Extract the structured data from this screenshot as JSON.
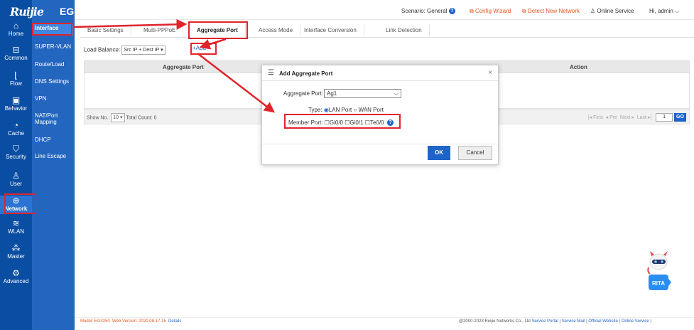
{
  "brand": {
    "logo": "Ruijie",
    "product": "EG"
  },
  "iconbar": {
    "items": [
      {
        "label": "Home",
        "icon": "home-icon",
        "glyph": "⌂"
      },
      {
        "label": "Common",
        "icon": "briefcase-icon",
        "glyph": "⊟"
      },
      {
        "label": "Flow",
        "icon": "chart-icon",
        "glyph": "⌊"
      },
      {
        "label": "Behavior",
        "icon": "behavior-icon",
        "glyph": "▣"
      },
      {
        "label": "Cache",
        "icon": "gauge-icon",
        "glyph": "◔"
      },
      {
        "label": "Security",
        "icon": "shield-icon",
        "glyph": "⛉"
      },
      {
        "label": "User",
        "icon": "user-icon",
        "glyph": "♙"
      },
      {
        "label": "Network",
        "icon": "globe-icon",
        "glyph": "⊕"
      },
      {
        "label": "WLAN",
        "icon": "wifi-icon",
        "glyph": "≋"
      },
      {
        "label": "Master",
        "icon": "tree-icon",
        "glyph": "⁂"
      },
      {
        "label": "Advanced",
        "icon": "gear-icon",
        "glyph": "⚙"
      }
    ]
  },
  "subnav": {
    "items": [
      "Interface",
      "SUPER-VLAN",
      "Route/Load",
      "DNS Settings",
      "VPN",
      "NAT/Port Mapping",
      "DHCP",
      "Line Escape"
    ],
    "active": "Interface"
  },
  "topbar": {
    "scenario": "Scenario: General",
    "config_wizard": "Config Wizard",
    "detect_network": "Detect New Network",
    "online_service": "Online Service",
    "user_greeting": "Hi, admin"
  },
  "tabs": [
    "Basic Settings",
    "Multi-PPPoE",
    "Aggregate Port",
    "Access Mode",
    "Interface Conversion",
    "Link Detection"
  ],
  "active_tab": "Aggregate Port",
  "toolbar": {
    "load_balance_label": "Load Balance:",
    "load_balance_value": "Src IP + Dest IP",
    "add_label": "Add"
  },
  "table": {
    "columns": [
      "Aggregate Port",
      "Action"
    ],
    "show_no_label": "Show No.:",
    "show_no_value": "10",
    "total_count": "Total Count: 0",
    "pager": {
      "first": "First",
      "prev": "Pre",
      "next": "Next",
      "last": "Last",
      "page": "1",
      "go": "GO"
    }
  },
  "modal": {
    "title": "Add Aggregate Port",
    "close": "×",
    "aggregate_port_label": "Aggregate Port:",
    "aggregate_port_value": "Ag1",
    "type_label": "Type:",
    "type_options": [
      {
        "label": "LAN Port",
        "selected": true
      },
      {
        "label": "WAN Port",
        "selected": false
      }
    ],
    "member_port_label": "Member Port:",
    "member_ports": [
      "Gi0/0",
      "Gi0/1",
      "Te0/0"
    ],
    "ok_label": "OK",
    "cancel_label": "Cancel"
  },
  "footer": {
    "model": "Model: EG3250",
    "web_version": "Web Version: 2020.08.17.15",
    "details": "Details",
    "copyright": "@2000-2023 Ruijie Networks Co., Ltd",
    "links": [
      "Service Portal",
      "Service Mail",
      "Official Website",
      "Online Service"
    ]
  },
  "mascot": {
    "label": "RITA"
  },
  "colors": {
    "sidebar_dark": "#0a4ea3",
    "sidebar_light": "#2366c0",
    "accent": "#1e63c8",
    "highlight": "#e0242c",
    "warning": "#e8561e"
  }
}
